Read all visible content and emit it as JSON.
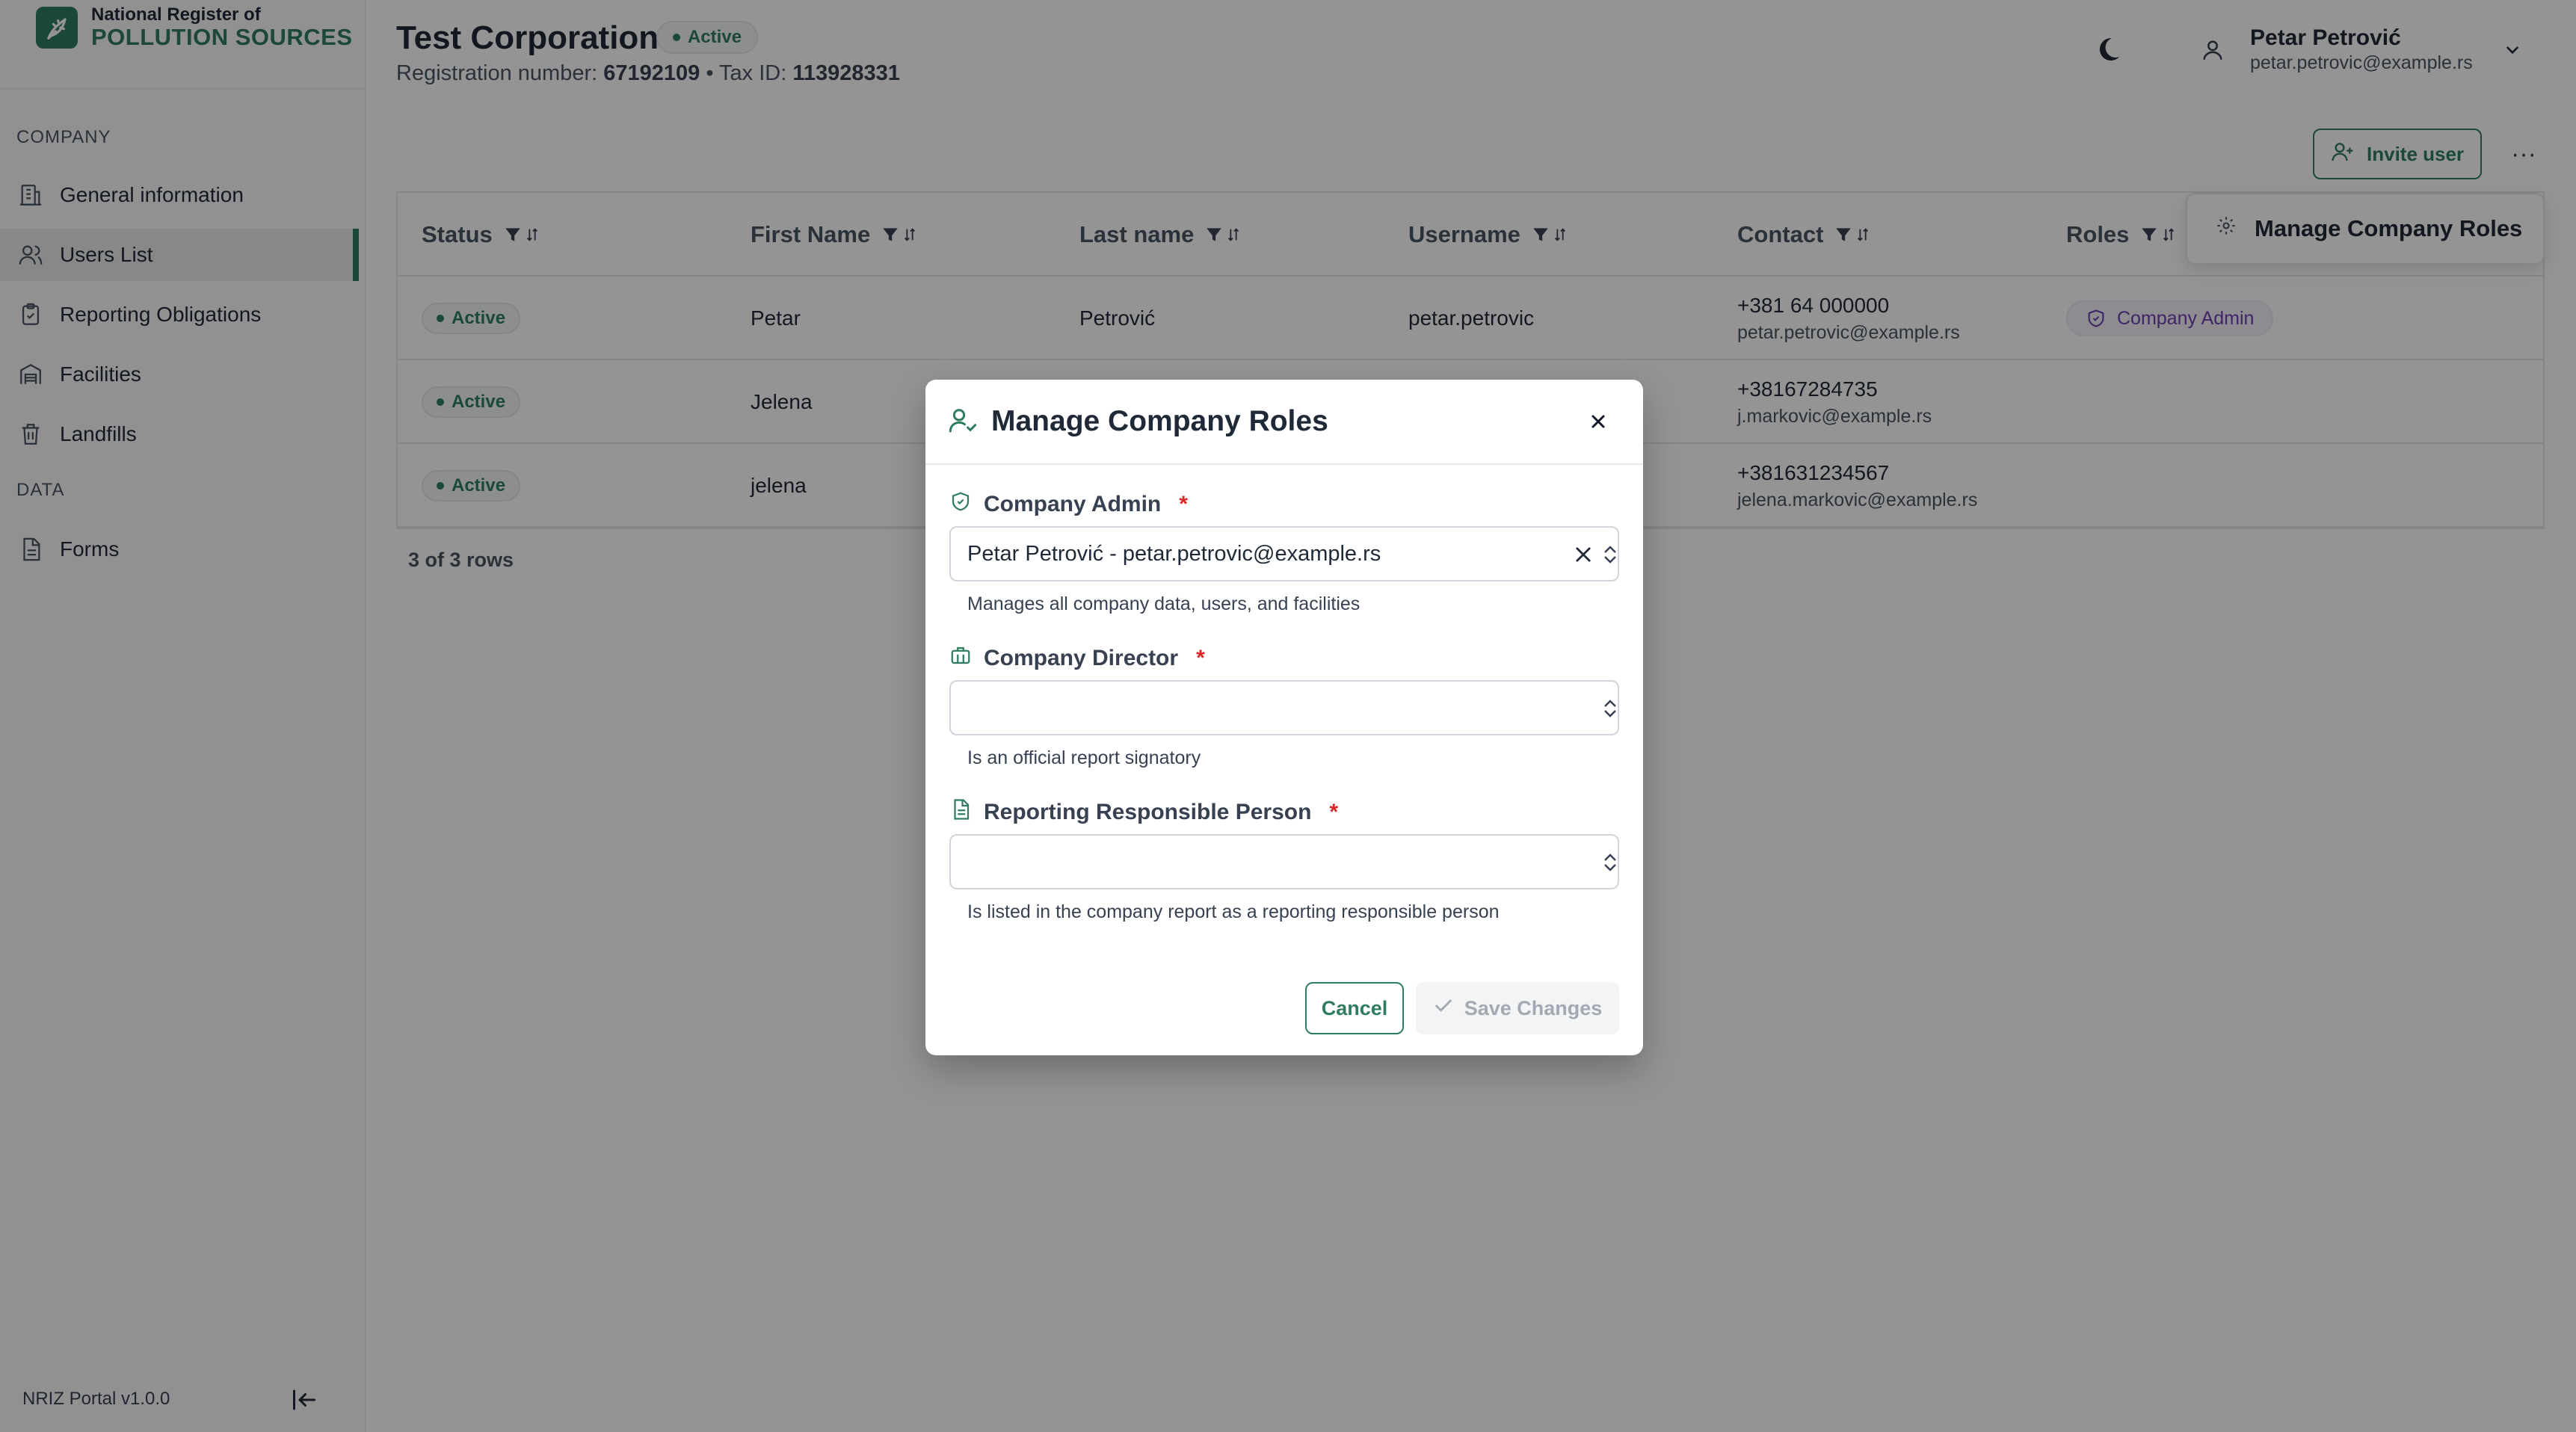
{
  "brand": {
    "line1": "National Register of",
    "line2": "POLLUTION SOURCES",
    "accent": "#2f7d5f"
  },
  "sidebar": {
    "sections": [
      {
        "label": "COMPANY",
        "items": [
          {
            "label": "General information",
            "icon": "building-icon",
            "active": false
          },
          {
            "label": "Users List",
            "icon": "users-icon",
            "active": true
          },
          {
            "label": "Reporting Obligations",
            "icon": "clipboard-icon",
            "active": false
          },
          {
            "label": "Facilities",
            "icon": "warehouse-icon",
            "active": false
          },
          {
            "label": "Landfills",
            "icon": "trash-icon",
            "active": false
          }
        ]
      },
      {
        "label": "DATA",
        "items": [
          {
            "label": "Forms",
            "icon": "document-icon",
            "active": false
          }
        ]
      }
    ],
    "footer_version": "NRIZ Portal v1.0.0"
  },
  "header": {
    "company_name": "Test Corporation",
    "status": "Active",
    "registration_label": "Registration number:",
    "registration_number": "67192109",
    "separator": "•",
    "tax_label": "Tax ID:",
    "tax_id": "113928331"
  },
  "user": {
    "name": "Petar Petrović",
    "email": "petar.petrovic@example.rs"
  },
  "toolbar": {
    "invite_label": "Invite user",
    "more_label": "···"
  },
  "table": {
    "columns": [
      "Status",
      "First Name",
      "Last name",
      "Username",
      "Contact",
      "Roles"
    ],
    "rows": [
      {
        "status": "Active",
        "first_name": "Petar",
        "last_name": "Petrović",
        "username": "petar.petrovic",
        "phone": "+381 64 000000",
        "email": "petar.petrovic@example.rs",
        "role": "Company Admin"
      },
      {
        "status": "Active",
        "first_name": "Jelena",
        "last_name": "",
        "username": "",
        "phone": "+38167284735",
        "email": "j.markovic@example.rs",
        "role": ""
      },
      {
        "status": "Active",
        "first_name": "jelena",
        "last_name": "",
        "username": "",
        "phone": "+381631234567",
        "email": "jelena.markovic@example.rs",
        "role": ""
      }
    ],
    "row_count": "3 of 3 rows"
  },
  "popover": {
    "label": "Manage Company Roles"
  },
  "modal": {
    "title": "Manage Company Roles",
    "fields": [
      {
        "label": "Company Admin",
        "required": "*",
        "value": "Petar Petrović - petar.petrovic@example.rs",
        "hint": "Manages all company data, users, and facilities"
      },
      {
        "label": "Company Director",
        "required": "*",
        "value": "",
        "hint": "Is an official report signatory"
      },
      {
        "label": "Reporting Responsible Person",
        "required": "*",
        "value": "",
        "hint": "Is listed in the company report as a reporting responsible person"
      }
    ],
    "cancel_label": "Cancel",
    "save_label": "Save Changes"
  }
}
